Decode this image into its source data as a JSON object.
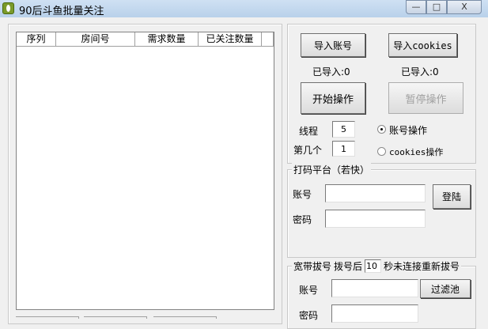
{
  "window": {
    "title": "90后斗鱼批量关注",
    "min": "—",
    "max": "□",
    "close": "X"
  },
  "table": {
    "columns": [
      "序列",
      "房间号",
      "需求数量",
      "已关注数量"
    ],
    "rows": []
  },
  "import": {
    "accounts_button": "导入账号",
    "cookies_button": "导入cookies",
    "accounts_count": "已导入:0",
    "cookies_count": "已导入:0"
  },
  "control": {
    "start_button": "开始操作",
    "pause_button": "暂停操作",
    "threads_label": "线程",
    "threads_value": "5",
    "index_label": "第几个",
    "index_value": "1",
    "radio_account": "账号操作",
    "radio_cookies": "cookies操作",
    "selected": "account"
  },
  "captcha": {
    "title": "打码平台（若快）",
    "account_label": "账号",
    "password_label": "密码",
    "account_value": "",
    "password_value": "",
    "login_button": "登陆"
  },
  "dialup": {
    "title": "宽带拔号",
    "prefix": "拨号后",
    "seconds": "10",
    "suffix": "秒未连接重新拔号",
    "account_label": "账号",
    "password_label": "密码",
    "account_value": "",
    "password_value": "",
    "filter_button": "过滤池"
  }
}
